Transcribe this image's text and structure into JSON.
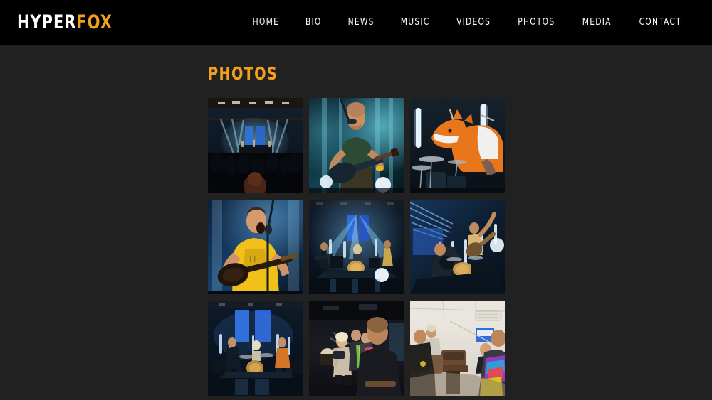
{
  "site": {
    "logo": {
      "part_a": "HYPER",
      "part_b": "FOX",
      "full": "HYPERFOX"
    },
    "colors": {
      "accent_orange": "#f2a01c",
      "header_black": "#000000",
      "page_background": "#212121",
      "nav_text": "#ffffff"
    }
  },
  "nav": {
    "items": [
      {
        "label": "HOME",
        "name": "nav-home"
      },
      {
        "label": "BIO",
        "name": "nav-bio"
      },
      {
        "label": "NEWS",
        "name": "nav-news"
      },
      {
        "label": "MUSIC",
        "name": "nav-music"
      },
      {
        "label": "VIDEOS",
        "name": "nav-videos"
      },
      {
        "label": "PHOTOS",
        "name": "nav-photos"
      },
      {
        "label": "MEDIA",
        "name": "nav-media"
      },
      {
        "label": "CONTACT",
        "name": "nav-contact"
      }
    ]
  },
  "main": {
    "title": "PHOTOS",
    "gallery": {
      "columns": 3,
      "rows": 3,
      "tile_size": 133,
      "photos": [
        {
          "position": 1,
          "caption": "Live concert stage seen over the crowd with blue spotlight beams",
          "scene": "crowd",
          "palette": {
            "bg": "#0b1420",
            "beam": "#6fc2e8",
            "screen": "#2b6fd6",
            "crowd": "#06080c"
          }
        },
        {
          "position": 2,
          "caption": "Singer-guitarist at the microphone lit by teal stage light",
          "scene": "guitarist-mic",
          "palette": {
            "bg": "#0d2733",
            "beam": "#3fb8cf",
            "skin": "#c98f63",
            "shirt": "#2f4a33"
          }
        },
        {
          "position": 3,
          "caption": "Drummer wearing an orange fox mascot head behind the kit",
          "scene": "fox-drummer",
          "palette": {
            "bg": "#111a22",
            "fox": "#e8761b",
            "fox_light": "#f0f2ef",
            "tube": "#eaf6ff"
          }
        },
        {
          "position": 4,
          "caption": "Bass player in a yellow shirt singing into the microphone",
          "scene": "yellow-bassist",
          "palette": {
            "bg": "#102034",
            "shirt": "#f2c119",
            "skin": "#d59b6e",
            "bass": "#3a2416"
          }
        },
        {
          "position": 5,
          "caption": "Wide shot of the full band on stage with blue light beams",
          "scene": "wide-stage",
          "palette": {
            "bg": "#0a111c",
            "beam": "#5aa7e0",
            "screen": "#2757c9",
            "floor": "#0e1722"
          }
        },
        {
          "position": 6,
          "caption": "Two band members performing between vertical light tubes",
          "scene": "two-members-tubes",
          "palette": {
            "bg": "#0c1626",
            "beam": "#4f9fd8",
            "tube": "#dff0ff",
            "skin": "#c08a5e"
          }
        },
        {
          "position": 7,
          "caption": "Full band on stage in front of two tall blue LED panels",
          "scene": "band-blue-panels",
          "palette": {
            "bg": "#0a1220",
            "panel": "#2f6ede",
            "tube": "#cfe6ff",
            "floor": "#10192a"
          }
        },
        {
          "position": 8,
          "caption": "Band members talking with an interviewer backstage",
          "scene": "backstage-interview",
          "palette": {
            "bg": "#15161a",
            "skin": "#c79a75",
            "coat": "#cbbda8",
            "accent": "#8cd0e6"
          }
        },
        {
          "position": 9,
          "caption": "Band relaxing together in a bright green room before the show",
          "scene": "green-room",
          "palette": {
            "bg": "#d8d4cc",
            "wall": "#e6e2da",
            "floor": "#8a7d6b",
            "jacket": "#3a3a3c"
          }
        }
      ]
    }
  }
}
